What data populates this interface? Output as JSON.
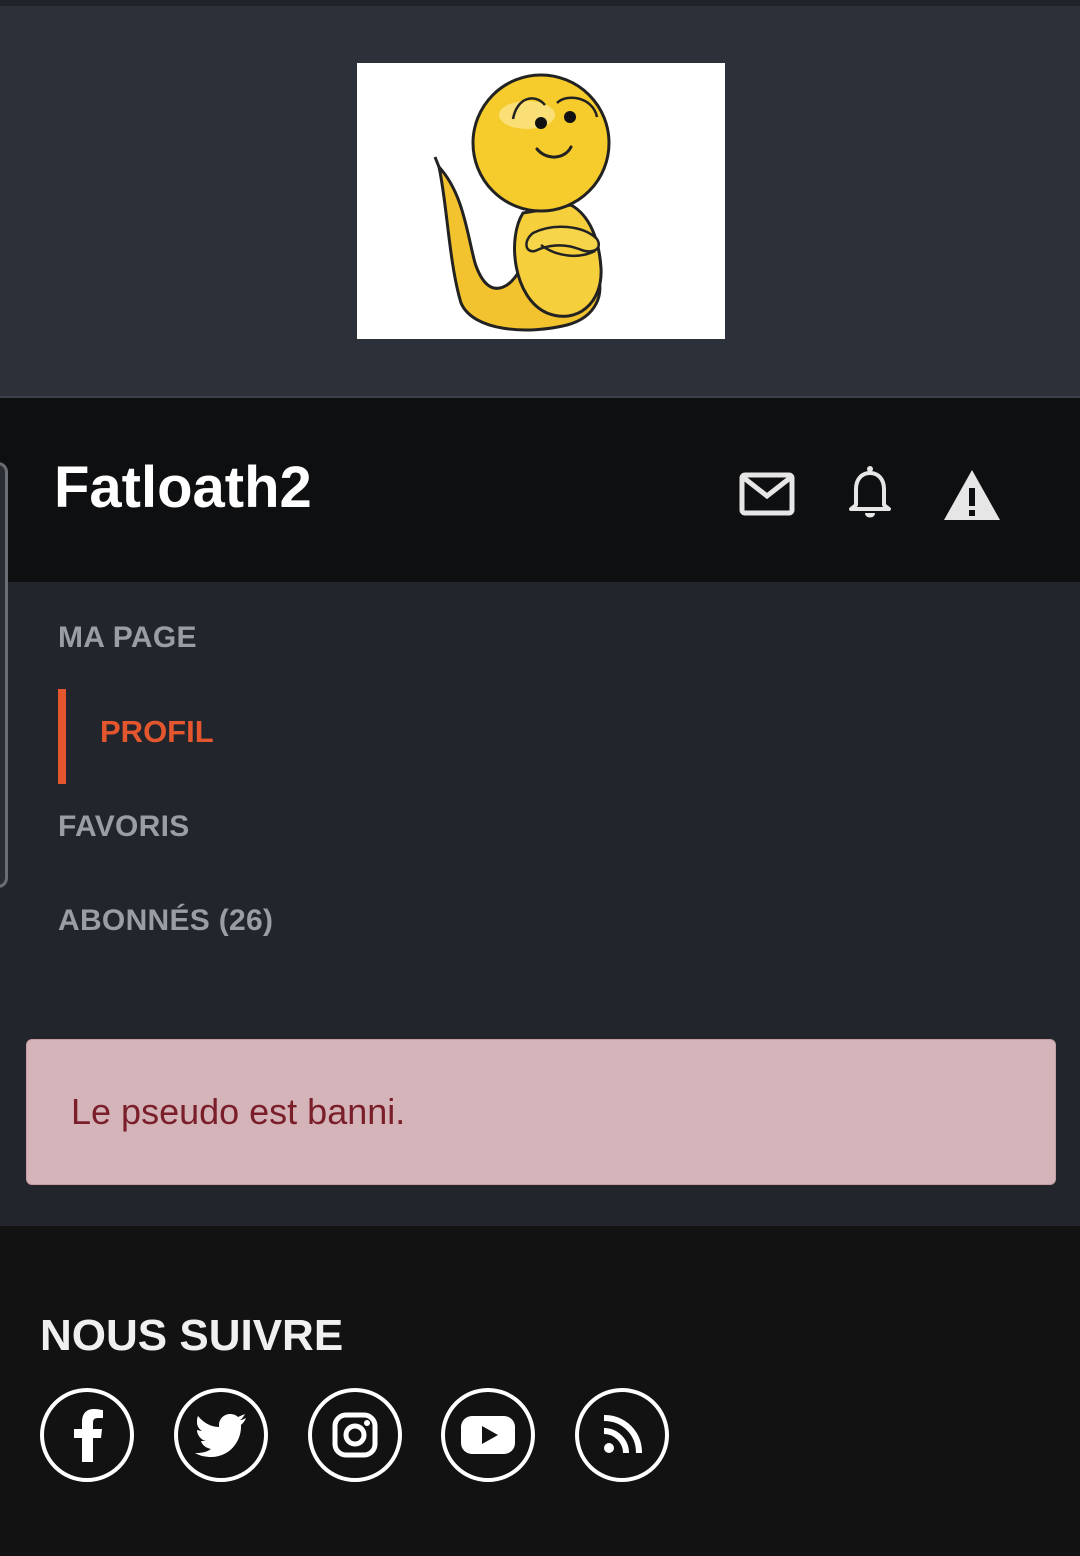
{
  "profile": {
    "username": "Fatloath2",
    "avatar_icon": "smiley-snake-avatar"
  },
  "header_icons": {
    "messages": "mail-icon",
    "notifications": "bell-icon",
    "report": "warning-icon"
  },
  "nav": {
    "section_title": "MA PAGE",
    "items": [
      {
        "label": "PROFIL",
        "active": true
      },
      {
        "label": "FAVORIS",
        "active": false
      },
      {
        "label": "ABONNÉS (26)",
        "active": false
      }
    ]
  },
  "alert": {
    "message": "Le pseudo est banni."
  },
  "footer": {
    "follow_title": "NOUS SUIVRE",
    "social": [
      "facebook-icon",
      "twitter-icon",
      "instagram-icon",
      "youtube-icon",
      "rss-icon"
    ]
  },
  "colors": {
    "accent": "#e4572e",
    "banner_bg": "#2c3038",
    "header_bg": "#0e0f11",
    "nav_bg": "#22262c",
    "alert_bg": "#d4b4b8",
    "alert_text": "#7a1f2a"
  }
}
